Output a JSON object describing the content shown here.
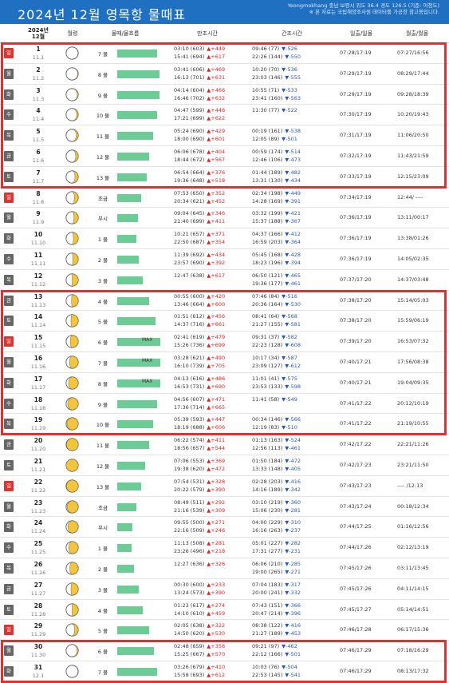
{
  "header": {
    "title": "2024년 12월 영목항 물때표",
    "note_line1": "Yeongmokhang 충남 보령시 위도 36.4 경도 126.5 (기준: 어청도)",
    "note_line2": "※ 본 자료는 국립해양조사원 데이터를 가공한 참고용입니다."
  },
  "columns": {
    "date_line1": "2024년",
    "date_line2": "12월",
    "moon": "월령",
    "tide": "물때/물흐름",
    "high": "만조시간",
    "low": "간조시간",
    "sun": "일출/일몰",
    "moonrise": "월출/월몰"
  },
  "colors": {
    "header_bg": "#1f70c1",
    "bar": "#6dcb95",
    "rise": "#dd2222",
    "fall": "#2a55b5",
    "highlight": "#e23030",
    "moon_fill": "#f3c53c"
  },
  "highlights": [
    {
      "from_day": 1,
      "to_day": 7
    },
    {
      "from_day": 13,
      "to_day": 19
    },
    {
      "from_day": 30,
      "to_day": 31
    }
  ],
  "rows": [
    {
      "day": "1",
      "lunar": "11.1",
      "dow": "일",
      "sun_day": true,
      "moon_phase": 0.02,
      "tide": "7 물",
      "flow": 0.62,
      "max": "",
      "h1": "03:10 (603)",
      "h1d": "▲+449",
      "h2": "15:41 (694)",
      "h2d": "▲+617",
      "l1": "09:46 (77)",
      "l1d": "▼-526",
      "l2": "22:26 (144)",
      "l2d": "▼-550",
      "sun": "07:28/17:19",
      "moonrs": "07:27/16:56"
    },
    {
      "day": "2",
      "lunar": "11.2",
      "dow": "월",
      "sun_day": false,
      "moon_phase": 0.05,
      "tide": "8 물",
      "flow": 0.66,
      "max": "",
      "h1": "03:41 (606)",
      "h1d": "▲+469",
      "h2": "16:13 (701)",
      "h2d": "▲+631",
      "l1": "10:20 (70)",
      "l1d": "▼-536",
      "l2": "23:03 (146)",
      "l2d": "▼-555",
      "sun": "07:29/17:19",
      "moonrs": "08:29/17:44"
    },
    {
      "day": "3",
      "lunar": "11.3",
      "dow": "화",
      "sun_day": false,
      "moon_phase": 0.08,
      "tide": "9 물",
      "flow": 0.66,
      "max": "",
      "h1": "04:14 (604)",
      "h1d": "▲+466",
      "h2": "16:46 (702)",
      "h2d": "▲+632",
      "l1": "10:55 (71)",
      "l1d": "▼-533",
      "l2": "23:41 (160)",
      "l2d": "▼-563",
      "sun": "07:29/17:19",
      "moonrs": "09:28/18:39"
    },
    {
      "day": "4",
      "lunar": "11.4",
      "dow": "수",
      "sun_day": false,
      "moon_phase": 0.12,
      "tide": "10 물",
      "flow": 0.62,
      "max": "",
      "h1": "04:47 (599)",
      "h1d": "▲+446",
      "h2": "17:21 (699)",
      "h2d": "▲+622",
      "l1": "11:30 (77)",
      "l1d": "▼-522",
      "l2": "",
      "l2d": "",
      "sun": "07:30/17:19",
      "moonrs": "10:20/19:43"
    },
    {
      "day": "5",
      "lunar": "11.5",
      "dow": "목",
      "sun_day": false,
      "moon_phase": 0.16,
      "tide": "11 물",
      "flow": 0.56,
      "max": "",
      "h1": "05:24 (690)",
      "h1d": "▲+429",
      "h2": "18:00 (690)",
      "h2d": "▲+601",
      "l1": "00:19 (161)",
      "l1d": "▼-538",
      "l2": "12:05 (89)",
      "l2d": "▼-501",
      "sun": "07:31/17:19",
      "moonrs": "11:06/20:50"
    },
    {
      "day": "6",
      "lunar": "11.6",
      "dow": "금",
      "sun_day": false,
      "moon_phase": 0.21,
      "tide": "12 물",
      "flow": 0.5,
      "max": "",
      "h1": "06:06 (678)",
      "h1d": "▲+404",
      "h2": "18:44 (672)",
      "h2d": "▲+567",
      "l1": "00:59 (174)",
      "l1d": "▼-514",
      "l2": "12:46 (106)",
      "l2d": "▼-473",
      "sun": "07:32/17:19",
      "moonrs": "11:43/21:59"
    },
    {
      "day": "7",
      "lunar": "11.7",
      "dow": "토",
      "sun_day": false,
      "moon_phase": 0.27,
      "tide": "13 물",
      "flow": 0.46,
      "max": "",
      "h1": "06:54 (664)",
      "h1d": "▲+376",
      "h2": "19:36 (648)",
      "h2d": "▲+518",
      "l1": "01:44 (189)",
      "l1d": "▼-482",
      "l2": "13:31 (130)",
      "l2d": "▼-434",
      "sun": "07:33/17:19",
      "moonrs": "12:15/23:09"
    },
    {
      "day": "8",
      "lunar": "11.8",
      "dow": "일",
      "sun_day": true,
      "moon_phase": 0.32,
      "tide": "조금",
      "flow": 0.38,
      "max": "",
      "h1": "07:53 (650)",
      "h1d": "▲+352",
      "h2": "20:34 (621)",
      "h2d": "▲+452",
      "l1": "02:34 (198)",
      "l1d": "▼-449",
      "l2": "14:28 (169)",
      "l2d": "▼-391",
      "sun": "07:34/17:19",
      "moonrs": "12:44/ ----"
    },
    {
      "day": "9",
      "lunar": "11.9",
      "dow": "월",
      "sun_day": false,
      "moon_phase": 0.36,
      "tide": "무시",
      "flow": 0.32,
      "max": "",
      "h1": "09:04 (645)",
      "h1d": "▲+346",
      "h2": "21:40 (699)",
      "h2d": "▲+411",
      "l1": "03:32 (199)",
      "l1d": "▼-421",
      "l2": "15:37 (188)",
      "l2d": "▼-367",
      "sun": "07:36/17:19",
      "moonrs": "13:11/00:17"
    },
    {
      "day": "10",
      "lunar": "11.10",
      "dow": "화",
      "sun_day": false,
      "moon_phase": 0.4,
      "tide": "1 물",
      "flow": 0.3,
      "max": "",
      "h1": "10:21 (657)",
      "h1d": "▲+371",
      "h2": "22:50 (687)",
      "h2d": "▲+354",
      "l1": "04:37 (166)",
      "l1d": "▼-412",
      "l2": "16:59 (203)",
      "l2d": "▼-364",
      "sun": "07:36/17:19",
      "moonrs": "13:38/01:26"
    },
    {
      "day": "11",
      "lunar": "11.11",
      "dow": "수",
      "sun_day": false,
      "moon_phase": 0.45,
      "tide": "2 물",
      "flow": 0.34,
      "max": "",
      "h1": "11:39 (692)",
      "h1d": "▲+434",
      "h2": "23:57 (690)",
      "h2d": "▲+392",
      "l1": "05:45 (168)",
      "l1d": "▼-428",
      "l2": "18:23 (196)",
      "l2d": "▼-394",
      "sun": "07:36/17:19",
      "moonrs": "14:05/02:35"
    },
    {
      "day": "12",
      "lunar": "11.12",
      "dow": "목",
      "sun_day": false,
      "moon_phase": 0.5,
      "tide": "3 물",
      "flow": 0.4,
      "max": "",
      "h1": "12:47 (638)",
      "h1d": "▲+617",
      "h2": "",
      "h2d": "",
      "l1": "06:50 (121)",
      "l1d": "▼-465",
      "l2": "19:36 (177)",
      "l2d": "▼-461",
      "sun": "07:37/17:20",
      "moonrs": "14:37/03:48"
    },
    {
      "day": "13",
      "lunar": "11.13",
      "dow": "금",
      "sun_day": false,
      "moon_phase": 0.55,
      "tide": "4 물",
      "flow": 0.5,
      "max": "",
      "h1": "00:55 (600)",
      "h1d": "▲+420",
      "h2": "13:46 (664)",
      "h2d": "▲+600",
      "l1": "07:46 (84)",
      "l1d": "▼-516",
      "l2": "20:36 (164)",
      "l2d": "▼-530",
      "sun": "07:38/17:20",
      "moonrs": "15:14/05:03"
    },
    {
      "day": "14",
      "lunar": "11.14",
      "dow": "토",
      "sun_day": false,
      "moon_phase": 0.6,
      "tide": "5 물",
      "flow": 0.6,
      "max": "",
      "h1": "01:51 (612)",
      "h1d": "▲+456",
      "h2": "14:37 (716)",
      "h2d": "▲+661",
      "l1": "08:41 (64)",
      "l1d": "▼-568",
      "l2": "21:27 (155)",
      "l2d": "▼-581",
      "sun": "07:38/17:20",
      "moonrs": "15:59/06:19"
    },
    {
      "day": "15",
      "lunar": "11.15",
      "dow": "일",
      "sun_day": true,
      "moon_phase": 0.66,
      "tide": "6 물",
      "flow": 0.68,
      "max": "MAX",
      "h1": "02:41 (619)",
      "h1d": "▲+479",
      "h2": "15:26 (736)",
      "h2d": "▲+699",
      "l1": "09:31 (37)",
      "l1d": "▼-582",
      "l2": "22:23 (128)",
      "l2d": "▼-608",
      "sun": "07:39/17:20",
      "moonrs": "16:53/07:32"
    },
    {
      "day": "16",
      "lunar": "11.16",
      "dow": "월",
      "sun_day": false,
      "moon_phase": 0.72,
      "tide": "7 물",
      "flow": 0.68,
      "max": "MAX",
      "h1": "03:28 (621)",
      "h1d": "▲+490",
      "h2": "16:10 (739)",
      "h2d": "▲+705",
      "l1": "10:17 (34)",
      "l1d": "▼-587",
      "l2": "23:09 (127)",
      "l2d": "▼-612",
      "sun": "07:40/17:21",
      "moonrs": "17:56/08:38"
    },
    {
      "day": "17",
      "lunar": "11.17",
      "dow": "화",
      "sun_day": false,
      "moon_phase": 0.8,
      "tide": "8 물",
      "flow": 0.68,
      "max": "MAX",
      "h1": "04:13 (616)",
      "h1d": "▲+486",
      "h2": "16:53 (731)",
      "h2d": "▲+690",
      "l1": "11:01 (41)",
      "l1d": "▼-575",
      "l2": "23:53 (133)",
      "l2d": "▼-598",
      "sun": "07:40/17:21",
      "moonrs": "19:04/09:35"
    },
    {
      "day": "18",
      "lunar": "11.18",
      "dow": "수",
      "sun_day": false,
      "moon_phase": 0.87,
      "tide": "9 물",
      "flow": 0.62,
      "max": "",
      "h1": "04:56 (607)",
      "h1d": "▲+471",
      "h2": "17:36 (714)",
      "h2d": "▲+665",
      "l1": "11:41 (58)",
      "l1d": "▼-549",
      "l2": "",
      "l2d": "",
      "sun": "07:41/17:22",
      "moonrs": "20:12/10:19"
    },
    {
      "day": "19",
      "lunar": "11.19",
      "dow": "목",
      "sun_day": false,
      "moon_phase": 0.93,
      "tide": "10 물",
      "flow": 0.56,
      "max": "",
      "h1": "05:39 (593)",
      "h1d": "▲+447",
      "h2": "18:19 (688)",
      "h2d": "▲+606",
      "l1": "00:34 (146)",
      "l1d": "▼-566",
      "l2": "12:19 (83)",
      "l2d": "▼-510",
      "sun": "07:41/17:22",
      "moonrs": "21:19/10:55"
    },
    {
      "day": "20",
      "lunar": "11.20",
      "dow": "금",
      "sun_day": false,
      "moon_phase": 0.97,
      "tide": "11 물",
      "flow": 0.5,
      "max": "",
      "h1": "06:22 (574)",
      "h1d": "▲+411",
      "h2": "18:56 (657)",
      "h2d": "▲+544",
      "l1": "01:13 (163)",
      "l1d": "▼-524",
      "l2": "12:56 (113)",
      "l2d": "▼-461",
      "sun": "07:42/17:22",
      "moonrs": "22:21/11:26"
    },
    {
      "day": "21",
      "lunar": "11.21",
      "dow": "토",
      "sun_day": false,
      "moon_phase": 1.0,
      "tide": "12 물",
      "flow": 0.44,
      "max": "",
      "h1": "07:06 (553)",
      "h1d": "▲+369",
      "h2": "19:38 (620)",
      "h2d": "▲+472",
      "l1": "01:50 (184)",
      "l1d": "▼-472",
      "l2": "13:33 (148)",
      "l2d": "▼-405",
      "sun": "07:42/17:23",
      "moonrs": "23:21/11:50"
    },
    {
      "day": "22",
      "lunar": "11.22",
      "dow": "일",
      "sun_day": true,
      "moon_phase": 0.97,
      "tide": "13 물",
      "flow": 0.38,
      "max": "",
      "h1": "07:54 (531)",
      "h1d": "▲+328",
      "h2": "20:22 (579)",
      "h2d": "▲+390",
      "l1": "02:28 (203)",
      "l1d": "▼-416",
      "l2": "14:16 (189)",
      "l2d": "▼-342",
      "sun": "07:43/17:23",
      "moonrs": "---- /12:13"
    },
    {
      "day": "23",
      "lunar": "11.23",
      "dow": "월",
      "sun_day": false,
      "moon_phase": 0.92,
      "tide": "조금",
      "flow": 0.3,
      "max": "",
      "h1": "08:49 (511)",
      "h1d": "▲+292",
      "h2": "21:16 (539)",
      "h2d": "▲+309",
      "l1": "03:10 (219)",
      "l1d": "▼-360",
      "l2": "15:06 (230)",
      "l2d": "▼-281",
      "sun": "07:43/17:24",
      "moonrs": "00:18/12:34"
    },
    {
      "day": "24",
      "lunar": "11.24",
      "dow": "화",
      "sun_day": false,
      "moon_phase": 0.85,
      "tide": "무시",
      "flow": 0.24,
      "max": "",
      "h1": "09:55 (500)",
      "h1d": "▲+271",
      "h2": "22:16 (509)",
      "h2d": "▲+246",
      "l1": "04:00 (229)",
      "l1d": "▼-310",
      "l2": "16:16 (263)",
      "l2d": "▼-237",
      "sun": "07:44/17:25",
      "moonrs": "01:16/12:56"
    },
    {
      "day": "25",
      "lunar": "11.25",
      "dow": "수",
      "sun_day": false,
      "moon_phase": 0.78,
      "tide": "1 물",
      "flow": 0.22,
      "max": "",
      "h1": "11:13 (508)",
      "h1d": "▲+281",
      "h2": "23:26 (496)",
      "h2d": "▲+218",
      "l1": "05:01 (227)",
      "l1d": "▼-282",
      "l2": "17:31 (277)",
      "l2d": "▼-231",
      "sun": "07:44/17:26",
      "moonrs": "02:12/13:19"
    },
    {
      "day": "26",
      "lunar": "11.26",
      "dow": "목",
      "sun_day": false,
      "moon_phase": 0.7,
      "tide": "2 물",
      "flow": 0.26,
      "max": "",
      "h1": "12:27 (636)",
      "h1d": "▲+326",
      "h2": "",
      "h2d": "",
      "l1": "06:06 (210)",
      "l1d": "▼-285",
      "l2": "19:00 (265)",
      "l2d": "▼-271",
      "sun": "07:45/17:26",
      "moonrs": "03:11/13:45"
    },
    {
      "day": "27",
      "lunar": "11.27",
      "dow": "금",
      "sun_day": false,
      "moon_phase": 0.6,
      "tide": "3 물",
      "flow": 0.34,
      "max": "",
      "h1": "00:30 (600)",
      "h1d": "▲+233",
      "h2": "13:24 (573)",
      "h2d": "▲+390",
      "l1": "07:04 (183)",
      "l1d": "▼-317",
      "l2": "20:00 (241)",
      "l2d": "▼-332",
      "sun": "07:45/17:26",
      "moonrs": "04:11/14:15"
    },
    {
      "day": "28",
      "lunar": "11.28",
      "dow": "토",
      "sun_day": false,
      "moon_phase": 0.5,
      "tide": "4 물",
      "flow": 0.4,
      "max": "",
      "h1": "01:23 (617)",
      "h1d": "▲+274",
      "h2": "14:10 (610)",
      "h2d": "▲+459",
      "l1": "07:43 (151)",
      "l1d": "▼-366",
      "l2": "20:47 (214)",
      "l2d": "▼-396",
      "sun": "07:45/17:27",
      "moonrs": "05:14/14:51"
    },
    {
      "day": "29",
      "lunar": "11.29",
      "dow": "일",
      "sun_day": true,
      "moon_phase": 0.3,
      "tide": "5 물",
      "flow": 0.5,
      "max": "",
      "h1": "02:05 (638)",
      "h1d": "▲+322",
      "h2": "14:50 (620)",
      "h2d": "▲+530",
      "l1": "08:38 (122)",
      "l1d": "▼-416",
      "l2": "21:27 (189)",
      "l2d": "▼-453",
      "sun": "07:46/17:28",
      "moonrs": "06:17/15:36"
    },
    {
      "day": "30",
      "lunar": "11.30",
      "dow": "월",
      "sun_day": false,
      "moon_phase": 0.1,
      "tide": "6 물",
      "flow": 0.58,
      "max": "",
      "h1": "02:48 (659)",
      "h1d": "▲+358",
      "h2": "15:25 (667)",
      "h2d": "▲+570",
      "l1": "09:21 (97)",
      "l1d": "▼-462",
      "l2": "22:12 (166)",
      "l2d": "▼-501",
      "sun": "07:46/17:29",
      "moonrs": "07:18/16:29"
    },
    {
      "day": "31",
      "lunar": "12.1",
      "dow": "화",
      "sun_day": false,
      "moon_phase": 0.02,
      "tide": "7 물",
      "flow": 0.62,
      "max": "",
      "h1": "03:26 (679)",
      "h1d": "▲+410",
      "h2": "15:58 (693)",
      "h2d": "▲+612",
      "l1": "10:03 (76)",
      "l1d": "▼-504",
      "l2": "22:53 (145)",
      "l2d": "▼-541",
      "sun": "07:46/17:29",
      "moonrs": "08:13/17:32"
    }
  ]
}
